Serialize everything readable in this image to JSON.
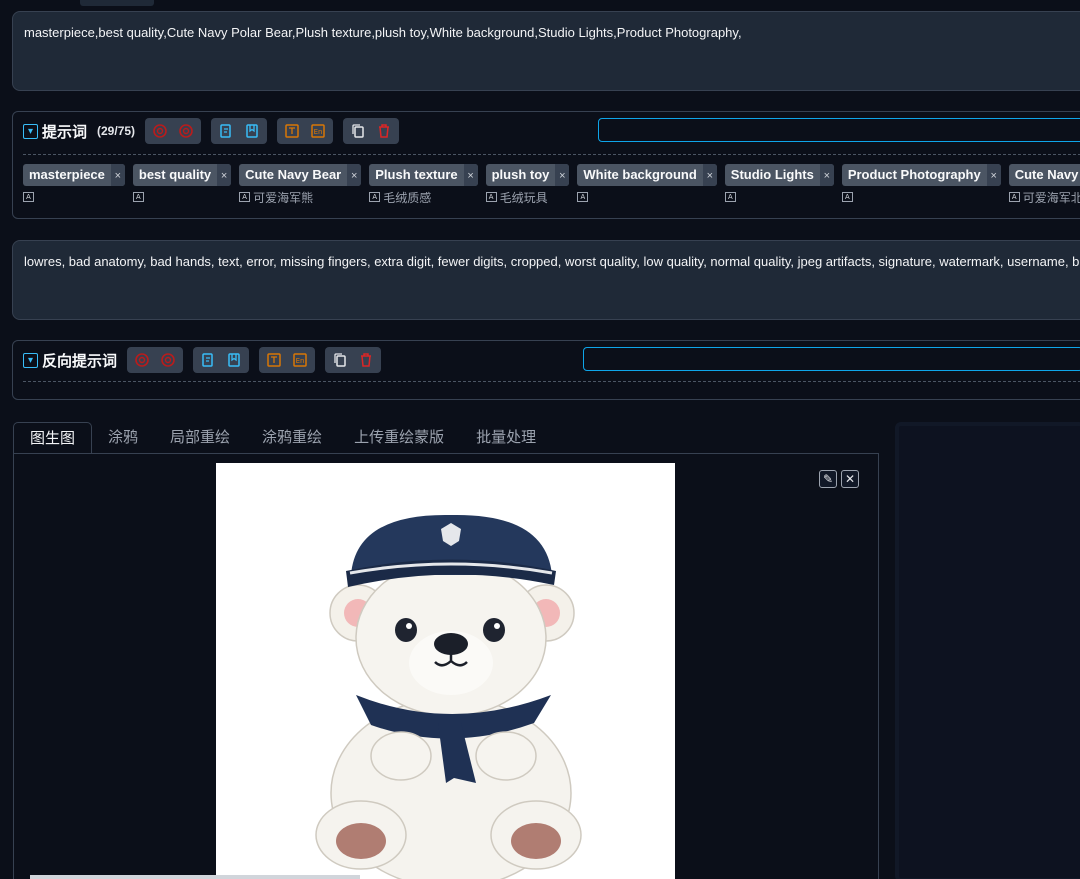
{
  "positive_prompt": {
    "text": "masterpiece,best quality,Cute Navy Polar Bear,Plush texture,plush toy,White background,Studio Lights,Product Photography,"
  },
  "prompt_panel": {
    "title": "提示词",
    "count": "(29/75)",
    "tags": [
      {
        "label": "masterpiece",
        "translation": ""
      },
      {
        "label": "best quality",
        "translation": ""
      },
      {
        "label": "Cute Navy Bear",
        "translation": "可爱海军熊"
      },
      {
        "label": "Plush texture",
        "translation": "毛绒质感"
      },
      {
        "label": "plush toy",
        "translation": "毛绒玩具"
      },
      {
        "label": "White background",
        "translation": ""
      },
      {
        "label": "Studio Lights",
        "translation": ""
      },
      {
        "label": "Product Photography",
        "translation": ""
      },
      {
        "label": "Cute Navy Pola",
        "translation": "可爱海军北极"
      }
    ]
  },
  "negative_prompt": {
    "text": "lowres, bad anatomy, bad hands, text, error, missing fingers, extra digit, fewer digits, cropped, worst quality, low quality, normal quality, jpeg artifacts, signature, watermark, username, blurry"
  },
  "negative_panel": {
    "title": "反向提示词"
  },
  "tabs": [
    "图生图",
    "涂鸦",
    "局部重绘",
    "涂鸦重绘",
    "上传重绘蒙版",
    "批量处理"
  ],
  "icons": {
    "collapse": "chevron-down-icon",
    "translate": "translate-icon",
    "edit": "pencil-icon",
    "close": "close-icon"
  },
  "colors": {
    "accent": "#0ea5e9",
    "danger": "#dc2626",
    "warning": "#d97706",
    "info": "#0ea5e9"
  }
}
